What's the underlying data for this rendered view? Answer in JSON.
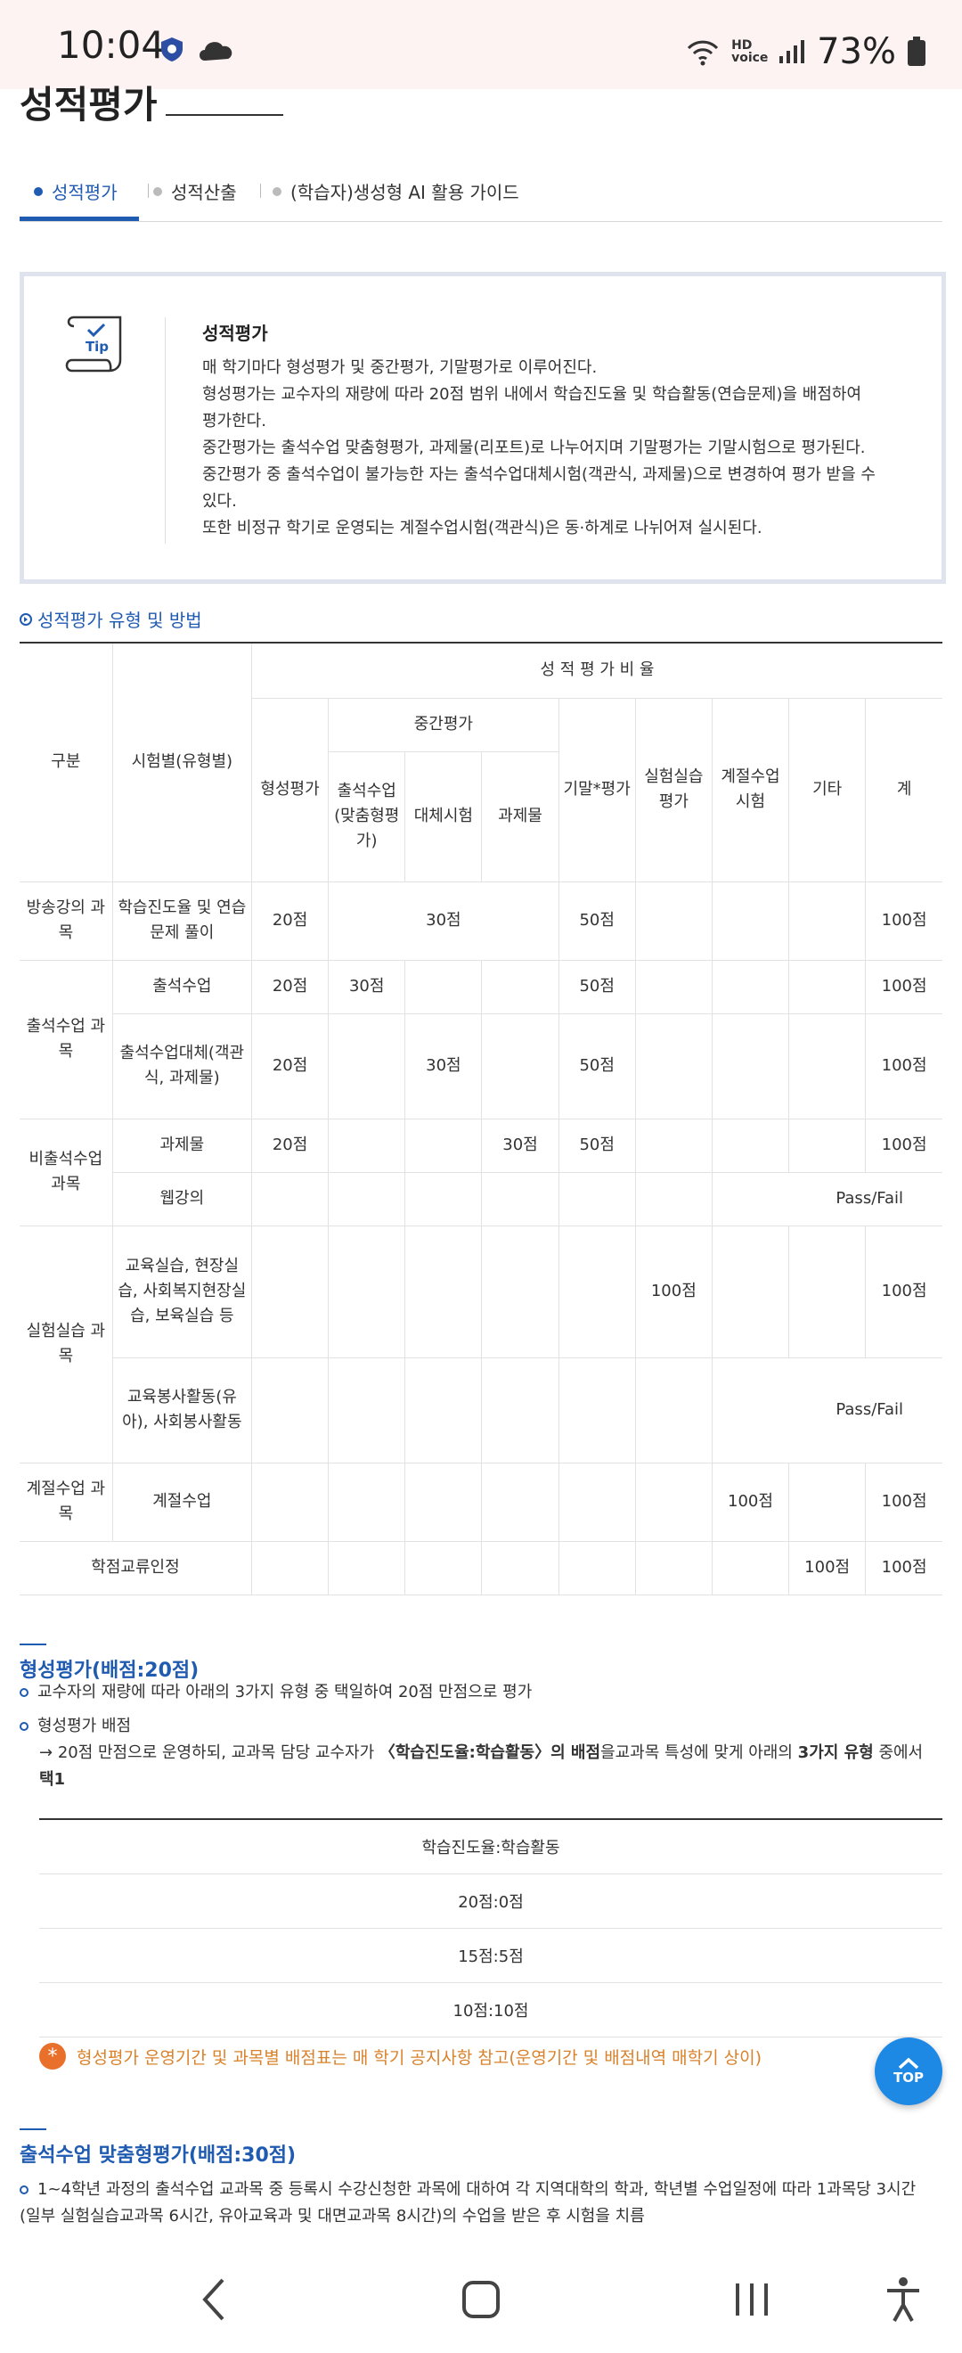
{
  "status": {
    "time": "10:04",
    "battery": "73%",
    "network": "HD voice"
  },
  "page": {
    "title": "성적평가"
  },
  "tabs": [
    {
      "label": "성적평가",
      "active": true
    },
    {
      "label": "성적산출",
      "active": false
    },
    {
      "label": "(학습자)생성형 AI 활용 가이드",
      "active": false
    }
  ],
  "tip": {
    "icon_label": "Tip",
    "title": "성적평가",
    "lines": [
      "매 학기마다 형성평가 및 중간평가, 기말평가로 이루어진다.",
      "형성평가는 교수자의 재량에 따라 20점 범위 내에서 학습진도율 및 학습활동(연습문제)을 배점하여",
      "평가한다.",
      "중간평가는 출석수업 맞춤형평가, 과제물(리포트)로 나누어지며 기말평가는 기말시험으로 평가된다.",
      "중간평가 중 출석수업이 불가능한 자는 출석수업대체시험(객관식, 과제물)으로 변경하여 평가 받을 수",
      "있다.",
      "또한 비정규 학기로 운영되는 계절수업시험(객관식)은 동·하계로 나뉘어져 실시된다."
    ]
  },
  "section1": {
    "title": "성적평가 유형 및 방법"
  },
  "grade_table": {
    "h_gubun": "구분",
    "h_type": "시험별(유형별)",
    "h_ratio": "성 적 평 가 비 율",
    "h_formative": "형성평가",
    "h_mid": "중간평가",
    "h_mid_attend": "출석수업(맞춤형평가)",
    "h_mid_alt": "대체시험",
    "h_mid_task": "과제물",
    "h_final": "기말*평가",
    "h_lab": "실험실습평가",
    "h_season": "계절수업시험",
    "h_etc": "기타",
    "h_total": "계",
    "r1_gubun": "방송강의 과목",
    "r1_type": "학습진도율 및 연습문제 풀이",
    "r1_form": "20점",
    "r1_mid": "30점",
    "r1_final": "50점",
    "r1_total": "100점",
    "g2": "출석수업 과목",
    "r2_type": "출석수업",
    "r2_form": "20점",
    "r2_att": "30점",
    "r2_final": "50점",
    "r2_total": "100점",
    "r3_type": "출석수업대체(객관식, 과제물)",
    "r3_form": "20점",
    "r3_alt": "30점",
    "r3_final": "50점",
    "r3_total": "100점",
    "g3": "비출석수업 과목",
    "r4_type": "과제물",
    "r4_form": "20점",
    "r4_task": "30점",
    "r4_final": "50점",
    "r4_total": "100점",
    "r5_type": "웹강의",
    "r5_pf": "Pass/Fail",
    "g4": "실험실습 과목",
    "r6_type": "교육실습, 현장실습, 사회복지현장실습, 보육실습 등",
    "r6_lab": "100점",
    "r6_total": "100점",
    "r7_type": "교육봉사활동(유아), 사회봉사활동",
    "r7_pf": "Pass/Fail",
    "r8_gubun": "계절수업 과목",
    "r8_type": "계절수업",
    "r8_season": "100점",
    "r8_total": "100점",
    "r9_gubun": "학점교류인정",
    "r9_etc": "100점",
    "r9_total": "100점"
  },
  "formative": {
    "title": "형성평가(배점:20점)",
    "bullet1": "교수자의 재량에 따라 아래의 3가지 유형 중 택일하여 20점 만점으로 평가",
    "bullet2": "형성평가 배점",
    "arrow_a": "20점 만점으로 운영하되, 교과목 담당 교수자가",
    "arrow_b": "〈학습진도율:학습활동〉의 배점",
    "arrow_c": "을교과목 특성에 맞게 아래의",
    "arrow_d": "3가지 유형",
    "arrow_e": "중에서",
    "arrow_f": "택1",
    "table_header": "학습진도율:학습활동",
    "rows": [
      "20점:0점",
      "15점:5점",
      "10점:10점"
    ],
    "notice": "형성평가 운영기간 및 과목별 배점표는 매 학기 공지사항 참고(운영기간 및 배점내역 매학기 상이)"
  },
  "attend": {
    "title": "출석수업 맞춤형평가(배점:30점)",
    "line1": "1~4학년 과정의 출석수업 교과목 중 등록시 수강신청한 과목에 대하여 각 지역대학의 학과, 학년별 수업일정에 따라 1과목당 3시간",
    "line2": "(일부 실험실습교과목 6시간, 유아교육과 및 대면교과목 8시간)의 수업을 받은 후 시험을 치름"
  },
  "top_button": {
    "label": "TOP"
  }
}
